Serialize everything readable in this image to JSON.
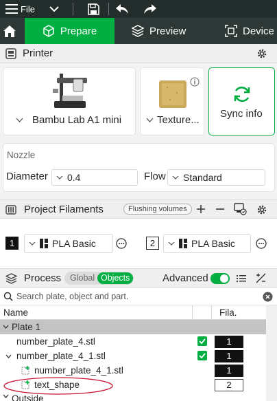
{
  "titlebar": {
    "file_label": "File",
    "icons": [
      "hamburger-icon",
      "chevron-down-icon",
      "save-icon",
      "undo-icon",
      "redo-icon"
    ]
  },
  "tabs": {
    "home_icon": "home-icon",
    "prepare": "Prepare",
    "preview": "Preview",
    "device": "Device"
  },
  "printer": {
    "header": "Printer",
    "printer_name": "Bambu Lab A1 mini",
    "plate_name": "Texture...",
    "sync_label": "Sync info",
    "nozzle_title": "Nozzle",
    "diameter_label": "Diameter",
    "diameter_value": "0.4",
    "flow_label": "Flow",
    "flow_value": "Standard"
  },
  "filaments": {
    "header": "Project Filaments",
    "flushing_label": "Flushing volumes",
    "items": [
      {
        "index": "1",
        "name": "PLA Basic"
      },
      {
        "index": "2",
        "name": "PLA Basic"
      }
    ]
  },
  "process": {
    "header": "Process",
    "global_label": "Global",
    "objects_label": "Objects",
    "advanced_label": "Advanced",
    "search_placeholder": "Search plate, object and part."
  },
  "objects": {
    "col_name": "Name",
    "col_fila": "Fila.",
    "plate_label": "Plate 1",
    "rows": [
      {
        "name": "number_plate_4.stl",
        "fila": "1"
      },
      {
        "name": "number_plate_4_1.stl",
        "fila": "1"
      },
      {
        "name": "number_plate_4_1.stl",
        "fila": "1"
      },
      {
        "name": "text_shape",
        "fila": "2"
      }
    ],
    "next_group_label": "Outside"
  },
  "colors": {
    "accent": "#00ae42",
    "titlebar": "#232d2b",
    "tabbar": "#2e3836",
    "annotation": "#c8102e"
  }
}
